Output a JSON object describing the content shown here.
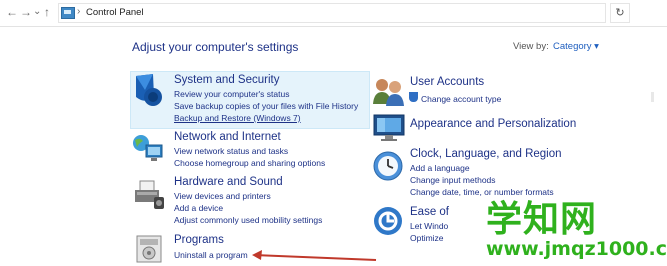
{
  "window": {
    "breadcrumb": "Control Panel",
    "nav": {
      "back": "←",
      "forward": "→",
      "recent": "⌄",
      "up": "↑"
    },
    "refresh": "↻"
  },
  "page": {
    "heading": "Adjust your computer's settings",
    "view_by_label": "View by:",
    "view_by_value": "Category ▾"
  },
  "left": [
    {
      "title": "System and Security",
      "icon": "shield-icon",
      "links": [
        "Review your computer's status",
        "Save backup copies of your files with File History",
        "Backup and Restore (Windows 7)"
      ]
    },
    {
      "title": "Network and Internet",
      "icon": "network-icon",
      "links": [
        "View network status and tasks",
        "Choose homegroup and sharing options"
      ]
    },
    {
      "title": "Hardware and Sound",
      "icon": "printer-icon",
      "links": [
        "View devices and printers",
        "Add a device",
        "Adjust commonly used mobility settings"
      ]
    },
    {
      "title": "Programs",
      "icon": "programs-icon",
      "links": [
        "Uninstall a program"
      ]
    }
  ],
  "right": [
    {
      "title": "User Accounts",
      "icon": "users-icon",
      "links": [
        "Change account type"
      ]
    },
    {
      "title": "Appearance and Personalization",
      "icon": "monitor-icon",
      "links": []
    },
    {
      "title": "Clock, Language, and Region",
      "icon": "clock-icon",
      "links": [
        "Add a language",
        "Change input methods",
        "Change date, time, or number formats"
      ]
    },
    {
      "title": "Ease of",
      "icon": "ease-of-access-icon",
      "links": [
        "Let Windo",
        "Optimize"
      ]
    }
  ],
  "watermark": {
    "chars": "学知网",
    "url": "www.jmqz1000.com"
  },
  "colors": {
    "link": "#1e3287",
    "highlight": "#e5f3fb",
    "arrow": "#c0392b",
    "watermark": "#2fb11d"
  }
}
